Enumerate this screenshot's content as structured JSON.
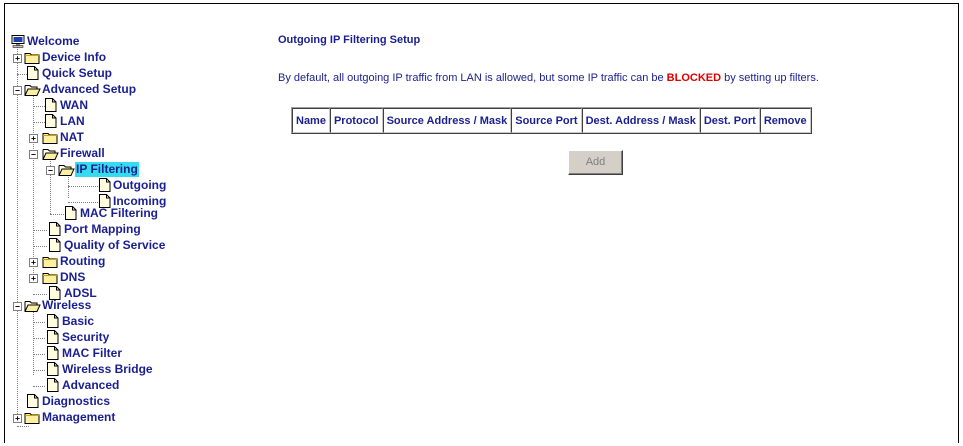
{
  "nav": {
    "welcome": "Welcome",
    "device_info": "Device Info",
    "quick_setup": "Quick Setup",
    "advanced_setup": "Advanced Setup",
    "wan": "WAN",
    "lan": "LAN",
    "nat": "NAT",
    "firewall": "Firewall",
    "ip_filtering": "IP Filtering",
    "outgoing": "Outgoing",
    "incoming": "Incoming",
    "mac_filtering": "MAC Filtering",
    "port_mapping": "Port Mapping",
    "qos": "Quality of Service",
    "routing": "Routing",
    "dns": "DNS",
    "adsl": "ADSL",
    "wireless": "Wireless",
    "basic": "Basic",
    "security": "Security",
    "mac_filter": "MAC Filter",
    "wireless_bridge": "Wireless Bridge",
    "advanced": "Advanced",
    "diagnostics": "Diagnostics",
    "management": "Management",
    "selected": "IP Filtering"
  },
  "main": {
    "title": "Outgoing IP Filtering Setup",
    "description_before": "By default, all outgoing IP traffic from LAN is allowed, but some IP traffic can be ",
    "description_blocked": "BLOCKED",
    "description_after": " by setting up filters.",
    "columns": [
      "Name",
      "Protocol",
      "Source Address / Mask",
      "Source Port",
      "Dest. Address / Mask",
      "Dest. Port",
      "Remove"
    ],
    "add_label": "Add"
  },
  "colors": {
    "link": "#1a1f8f",
    "blocked": "#e00000",
    "selected_highlight": "#33ddee"
  }
}
